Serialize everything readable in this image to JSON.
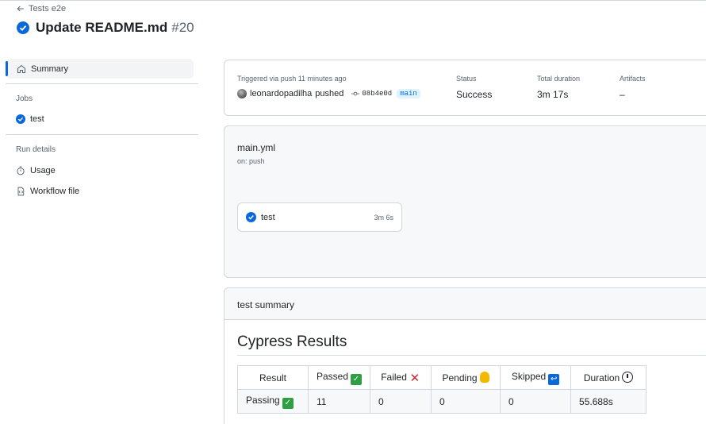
{
  "header": {
    "back_label": "Tests e2e",
    "title": "Update README.md",
    "run_number": "#20"
  },
  "sidebar": {
    "summary_label": "Summary",
    "jobs_heading": "Jobs",
    "jobs": [
      {
        "label": "test"
      }
    ],
    "run_details_heading": "Run details",
    "details": [
      {
        "label": "Usage"
      },
      {
        "label": "Workflow file"
      }
    ]
  },
  "trigger": {
    "label": "Triggered via push 11 minutes ago",
    "user": "leonardopadilha",
    "action": "pushed",
    "commit": "08b4e0d",
    "branch": "main",
    "status_label": "Status",
    "status_value": "Success",
    "duration_label": "Total duration",
    "duration_value": "3m 17s",
    "artifacts_label": "Artifacts",
    "artifacts_value": "–"
  },
  "workflow": {
    "file": "main.yml",
    "on": "on: push",
    "job": {
      "name": "test",
      "duration": "3m 6s"
    }
  },
  "summary": {
    "heading": "test summary",
    "results_title": "Cypress Results",
    "table": {
      "headers": [
        "Result",
        "Passed",
        "Failed",
        "Pending",
        "Skipped",
        "Duration"
      ],
      "row": [
        "Passing",
        "11",
        "0",
        "0",
        "0",
        "55.688s"
      ]
    }
  },
  "colors": {
    "accent": "#0969da",
    "success": "#2ea043",
    "border": "#d0d7de"
  }
}
